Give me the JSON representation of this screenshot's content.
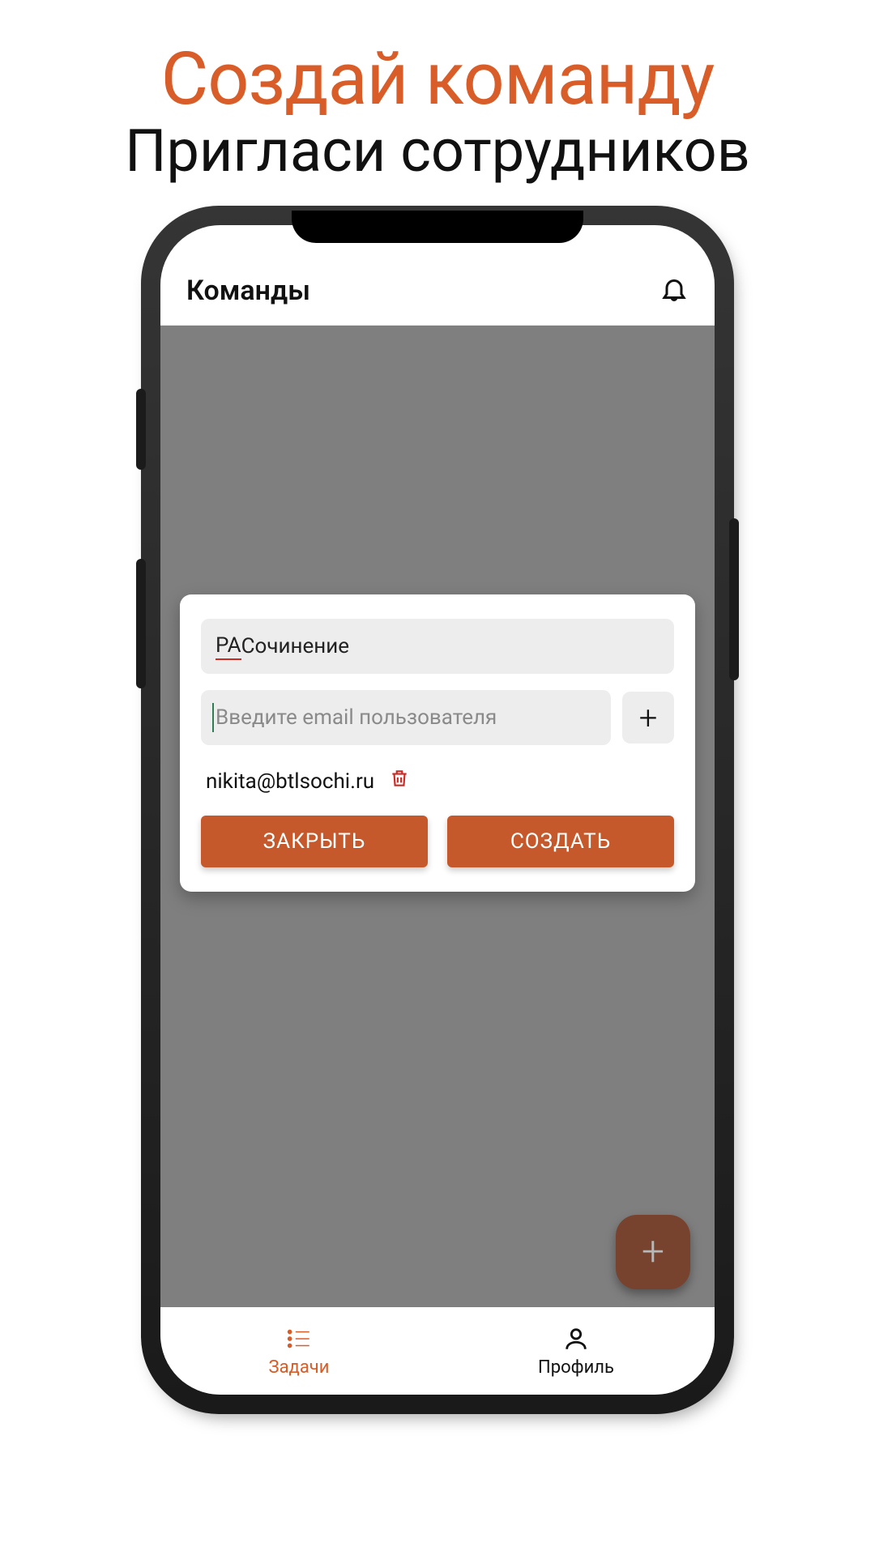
{
  "promo": {
    "title": "Создай команду",
    "subtitle": "Пригласи сотрудников"
  },
  "header": {
    "title": "Команды"
  },
  "modal": {
    "team_name_prefix": "РА",
    "team_name_rest": " Сочинение",
    "email_placeholder": "Введите email пользователя",
    "members": [
      {
        "email": "nikita@btlsochi.ru"
      }
    ],
    "close_label": "ЗАКРЫТЬ",
    "create_label": "СОЗДАТЬ"
  },
  "nav": {
    "items": [
      {
        "label": "Задачи",
        "active": true
      },
      {
        "label": "Профиль",
        "active": false
      }
    ]
  }
}
